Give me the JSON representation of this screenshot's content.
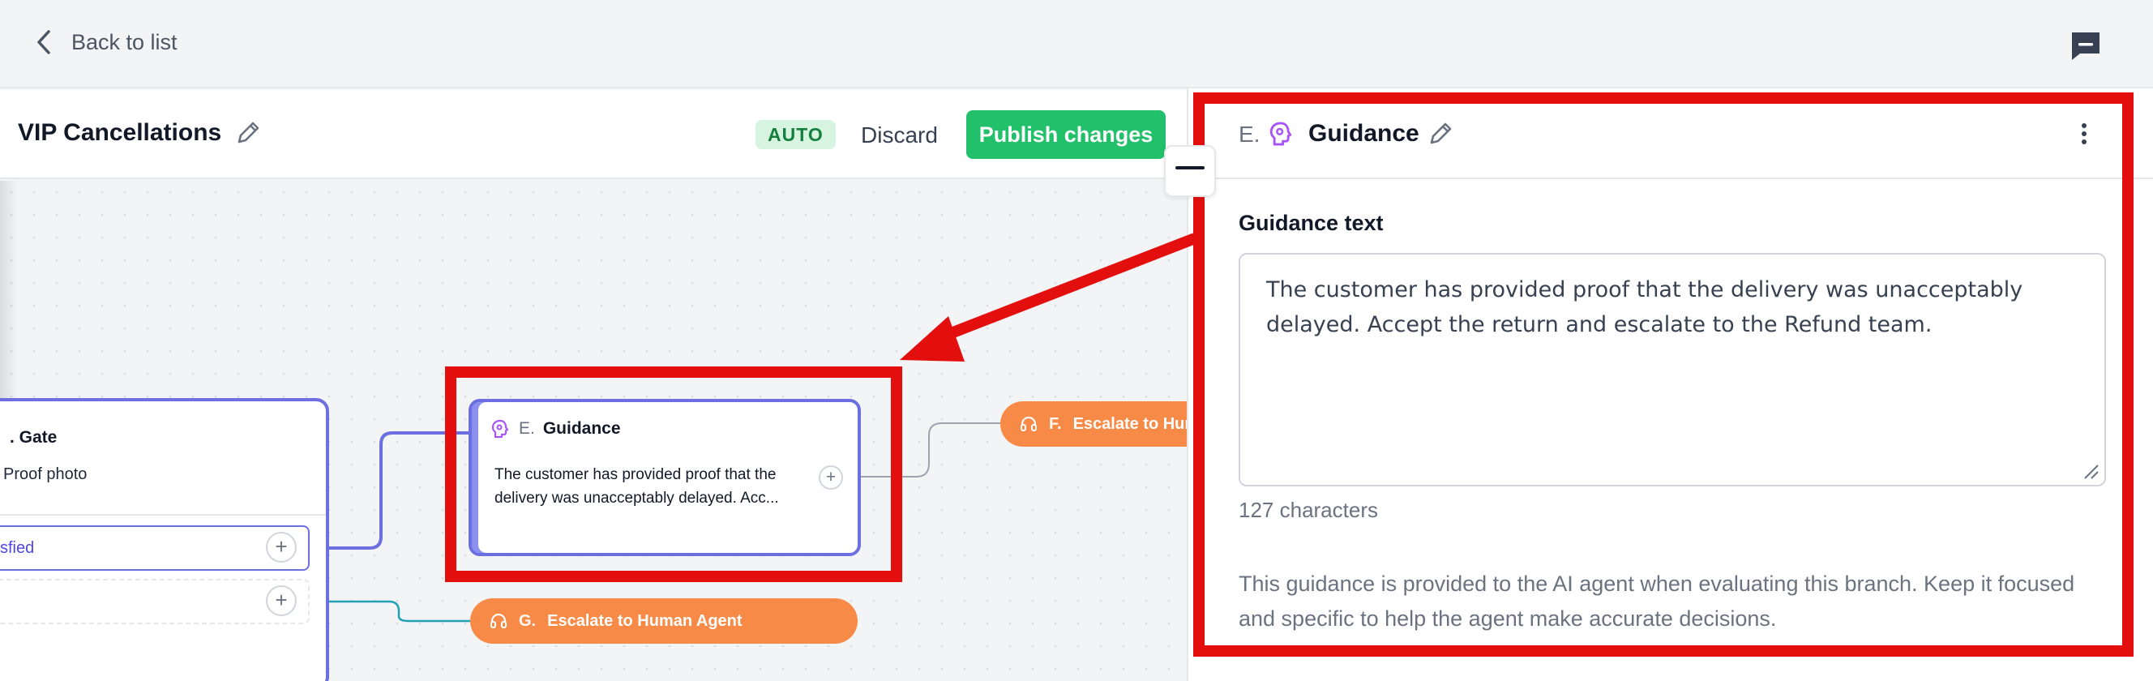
{
  "topbar": {
    "back_label": "Back to list"
  },
  "editor": {
    "flow_title": "VIP Cancellations",
    "badge": "AUTO",
    "discard_label": "Discard",
    "publish_label": "Publish changes"
  },
  "canvas": {
    "gate_node": {
      "title": ". Gate",
      "subtitle": "Proof photo",
      "branches": [
        {
          "label": "sfied"
        },
        {
          "label": ""
        }
      ]
    },
    "guidance_node": {
      "letter": "E.",
      "title": "Guidance",
      "body": "The customer has provided proof that the delivery was unacceptably delayed. Acc..."
    },
    "escalate_f": {
      "letter": "F.",
      "label": "Escalate to Hum"
    },
    "escalate_g": {
      "letter": "G.",
      "label": "Escalate to Human Agent"
    }
  },
  "panel": {
    "letter": "E.",
    "title": "Guidance",
    "field_label": "Guidance text",
    "field_value": "The customer has provided proof that the delivery was unacceptably delayed. Accept the return and escalate to the Refund team.",
    "char_count": "127 characters",
    "help_text": "This guidance is provided to the AI agent when evaluating this branch. Keep it focused and specific to help the agent make accurate decisions."
  },
  "colors": {
    "accent": "#6b6fe0",
    "publish_green": "#22c06a",
    "escalate_orange": "#f68a46",
    "annotation_red": "#e30f0f",
    "guidance_icon_purple": "#a855f7"
  },
  "icons": [
    "chevron-left-icon",
    "chat-icon",
    "pencil-icon",
    "brain-icon",
    "more-vertical-icon",
    "plus-icon",
    "headset-icon",
    "collapse-icon",
    "resize-grip-icon"
  ]
}
